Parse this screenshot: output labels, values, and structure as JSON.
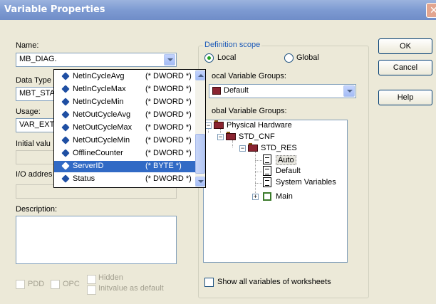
{
  "window": {
    "title": "Variable Properties",
    "close_glyph": "✕"
  },
  "buttons": {
    "ok": "OK",
    "cancel": "Cancel",
    "help": "Help"
  },
  "name": {
    "label": "Name:",
    "value": "MB_DIAG."
  },
  "data_type": {
    "label": "Data Type",
    "value": "MBT_STA"
  },
  "usage": {
    "label": "Usage:",
    "value": "VAR_EXT"
  },
  "initial_value": {
    "label": "Initial valu"
  },
  "io_address": {
    "label": "I/O addres"
  },
  "description": {
    "label": "Description:"
  },
  "options": {
    "pdd": "PDD",
    "opc": "OPC",
    "hidden": "Hidden",
    "initvalue": "Initvalue as default"
  },
  "scope": {
    "label": "Definition scope",
    "local": "Local",
    "global": "Global",
    "selected": "local"
  },
  "local_groups": {
    "label": "ocal Variable Groups:",
    "value": "Default"
  },
  "global_groups": {
    "label": "obal Variable Groups:"
  },
  "tree": [
    {
      "label": "Physical Hardware"
    },
    {
      "label": "STD_CNF"
    },
    {
      "label": "STD_RES"
    },
    {
      "label": "Auto"
    },
    {
      "label": "Default"
    },
    {
      "label": "System Variables"
    },
    {
      "label": "Main"
    }
  ],
  "show_all": {
    "label": "Show all variables of worksheets"
  },
  "popup": {
    "items": [
      {
        "name": "NetInCycleAvg",
        "type": "(* DWORD *)"
      },
      {
        "name": "NetInCycleMax",
        "type": "(* DWORD *)"
      },
      {
        "name": "NetInCycleMin",
        "type": "(* DWORD *)"
      },
      {
        "name": "NetOutCycleAvg",
        "type": "(* DWORD *)"
      },
      {
        "name": "NetOutCycleMax",
        "type": "(* DWORD *)"
      },
      {
        "name": "NetOutCycleMin",
        "type": "(* DWORD *)"
      },
      {
        "name": "OfflineCounter",
        "type": "(* DWORD *)"
      },
      {
        "name": "ServerID",
        "type": "(* BYTE *)"
      },
      {
        "name": "Status",
        "type": "(* DWORD *)"
      }
    ],
    "selected": "ServerID"
  }
}
